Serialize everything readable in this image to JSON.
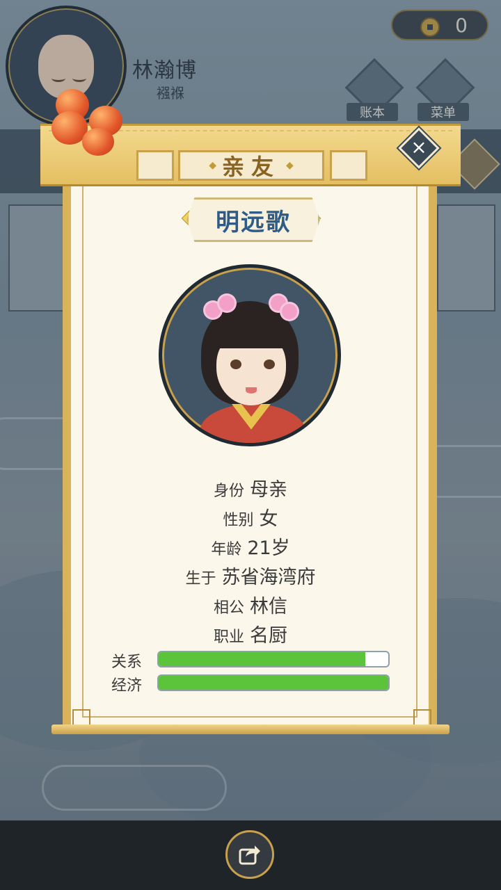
{
  "header": {
    "player_name": "林瀚博",
    "player_stage": "襁褓",
    "coins": "0",
    "buttons": [
      {
        "label": "账本",
        "icon": "ledger-icon"
      },
      {
        "label": "菜单",
        "icon": "menu-dots-icon"
      }
    ]
  },
  "dialog": {
    "title": "亲友",
    "person_name": "明远歌",
    "fields": [
      {
        "key": "身份",
        "value": "母亲"
      },
      {
        "key": "性别",
        "value": "女"
      },
      {
        "key": "年龄",
        "value": "21岁"
      },
      {
        "key": "生于",
        "value": "苏省海湾府"
      },
      {
        "key": "相公",
        "value": "林信"
      },
      {
        "key": "职业",
        "value": "名厨"
      }
    ],
    "bars": [
      {
        "label": "关系",
        "fraction": 0.9,
        "color": "#5bc43a"
      },
      {
        "label": "经济",
        "fraction": 1.0,
        "color": "#5bc43a"
      }
    ]
  },
  "footer": {
    "share_icon": "share-icon"
  }
}
